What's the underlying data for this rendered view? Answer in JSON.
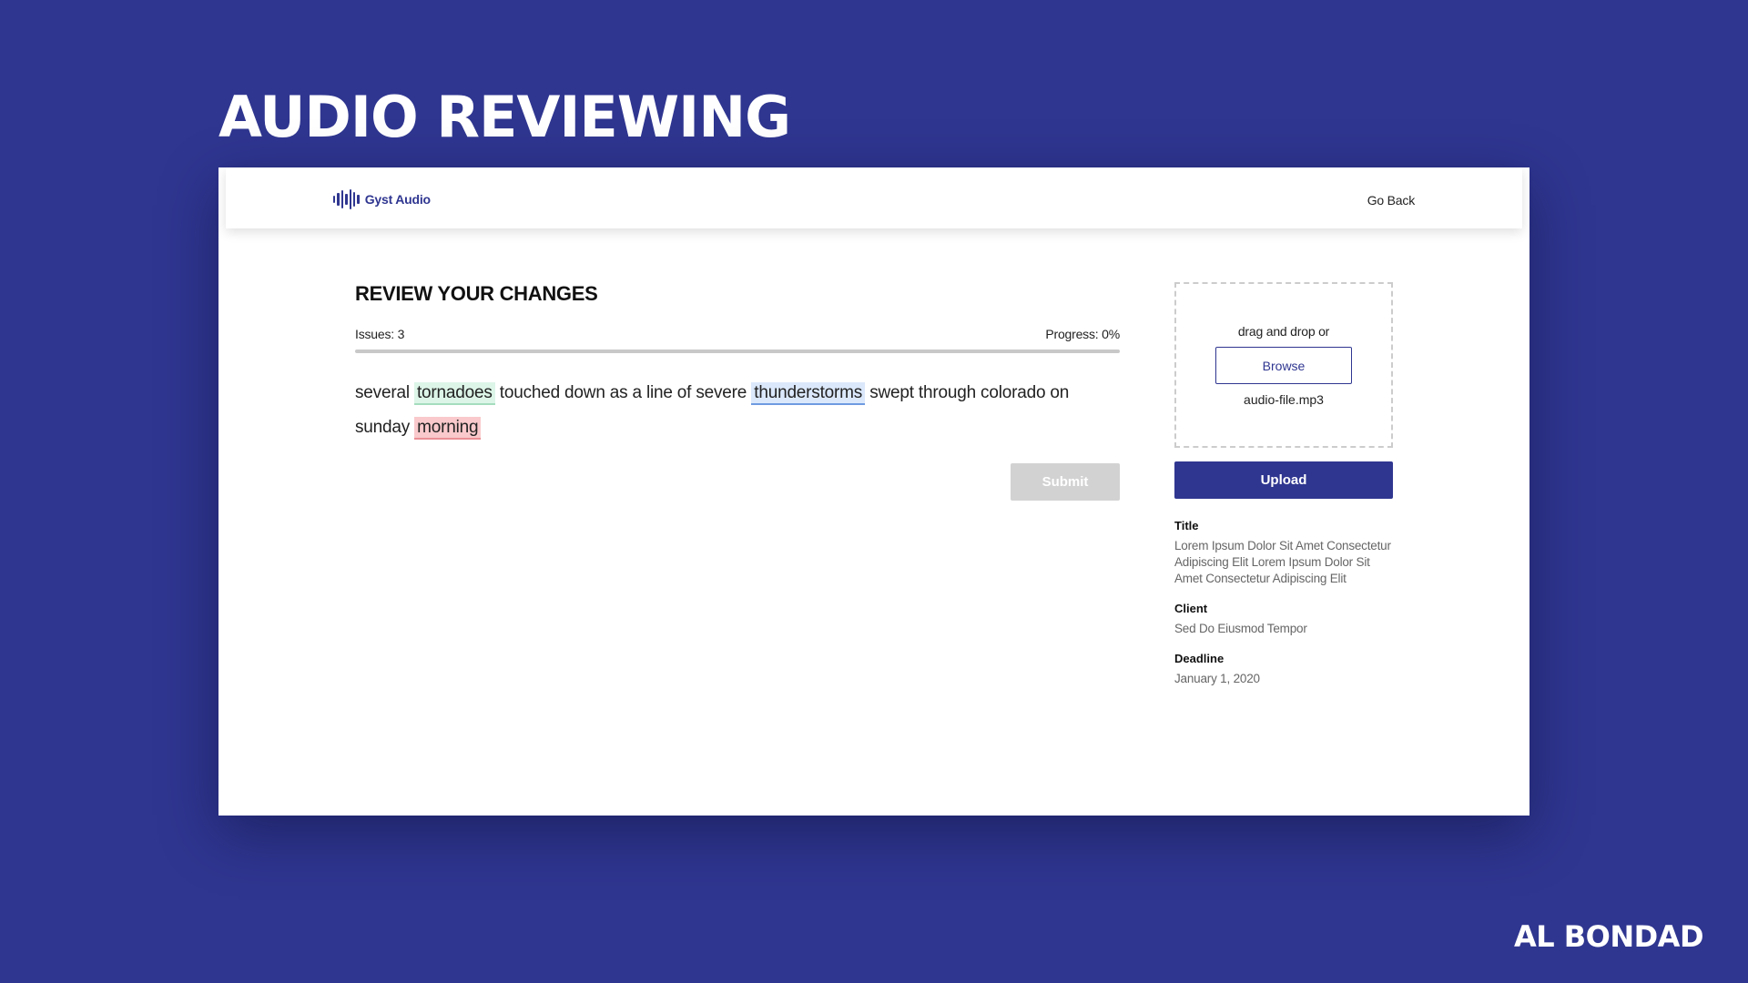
{
  "heading": "AUDIO REVIEWING",
  "author": "AL BONDAD",
  "colors": {
    "brand": "#2f3690",
    "background": "#2f3690",
    "highlight_green": "#dcf5e8",
    "highlight_blue": "#dbe8fb",
    "highlight_red": "#f9c9cb",
    "disabled": "#d2d2d2"
  },
  "header": {
    "logo_text": "Gyst Audio",
    "logo_icon": "waveform-icon",
    "go_back_label": "Go Back"
  },
  "review": {
    "title": "REVIEW YOUR CHANGES",
    "issues_label": "Issues: 3",
    "progress_label": "Progress: 0%",
    "progress_value": 0,
    "transcript": {
      "t1": "several",
      "hl1": "tornadoes",
      "t2": "touched down as a line of severe",
      "hl2": "thunderstorms",
      "t3": "swept through colorado on sunday",
      "hl3": "morning"
    },
    "submit_label": "Submit"
  },
  "upload": {
    "drop_text": "drag and drop or",
    "browse_label": "Browse",
    "file_name": "audio-file.mp3",
    "upload_label": "Upload"
  },
  "details": {
    "title_label": "Title",
    "title_value": "Lorem Ipsum Dolor Sit Amet Consectetur Adipiscing Elit Lorem Ipsum Dolor Sit Amet Consectetur Adipiscing Elit",
    "client_label": "Client",
    "client_value": "Sed Do Eiusmod Tempor",
    "deadline_label": "Deadline",
    "deadline_value": "January 1, 2020"
  }
}
